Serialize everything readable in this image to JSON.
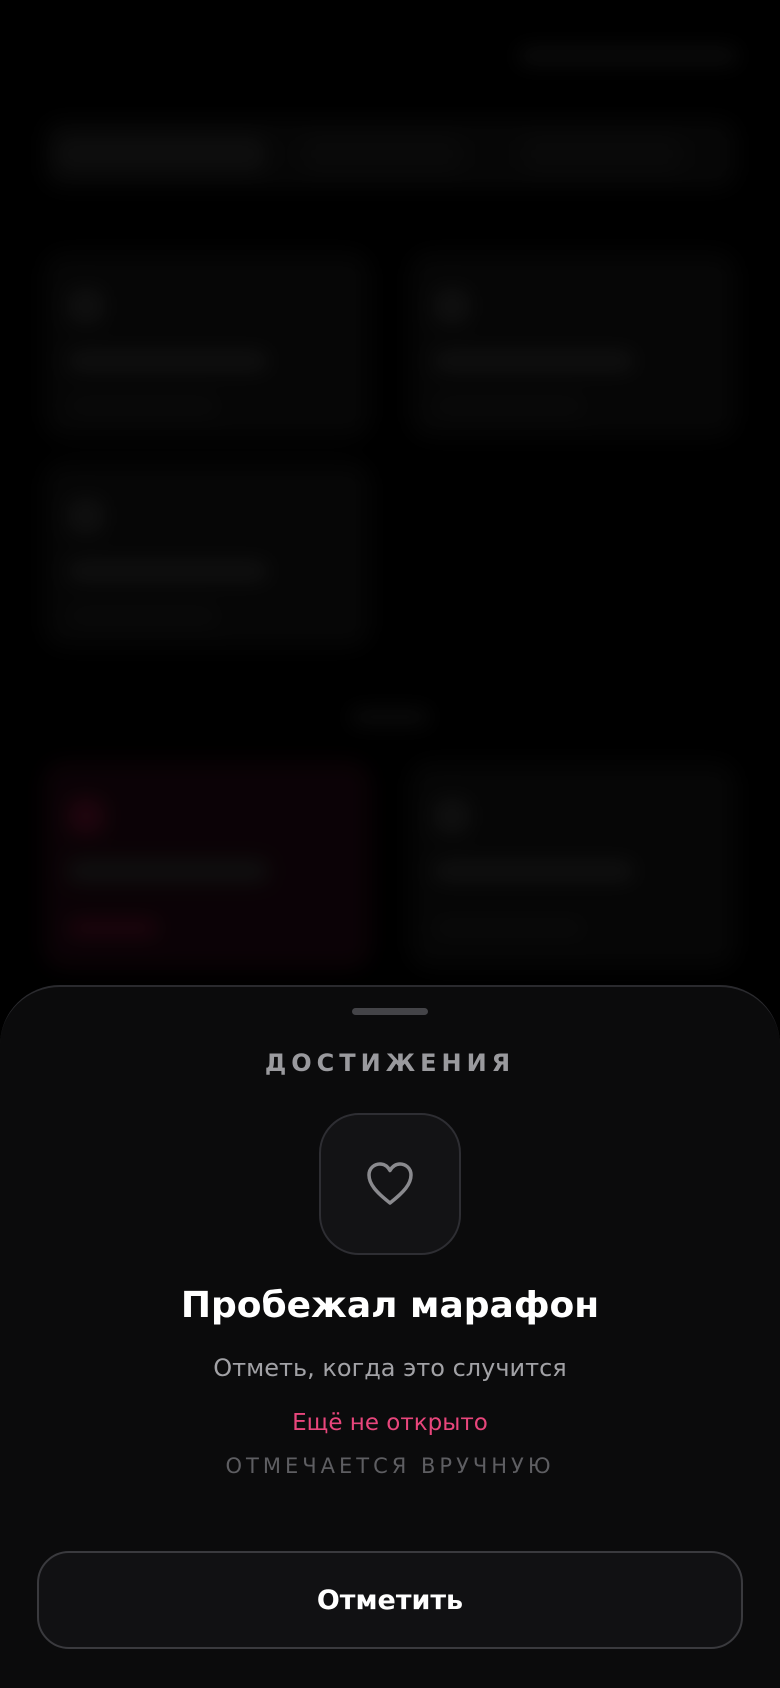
{
  "sheet": {
    "section_title": "ДОСТИЖЕНИЯ",
    "badge_icon": "heart-outline-icon",
    "achievement_title": "Пробежал марафон",
    "achievement_description": "Отметь, когда это случится",
    "status_text": "Ещё не открыто",
    "mode_text": "ОТМЕЧАЕТСЯ ВРУЧНУЮ",
    "action_button_label": "Отметить"
  },
  "colors": {
    "background": "#000000",
    "sheet_background": "#0b0b0c",
    "status_accent": "#e8467c",
    "title_text": "#ffffff",
    "muted_text": "#a2a2a6"
  }
}
